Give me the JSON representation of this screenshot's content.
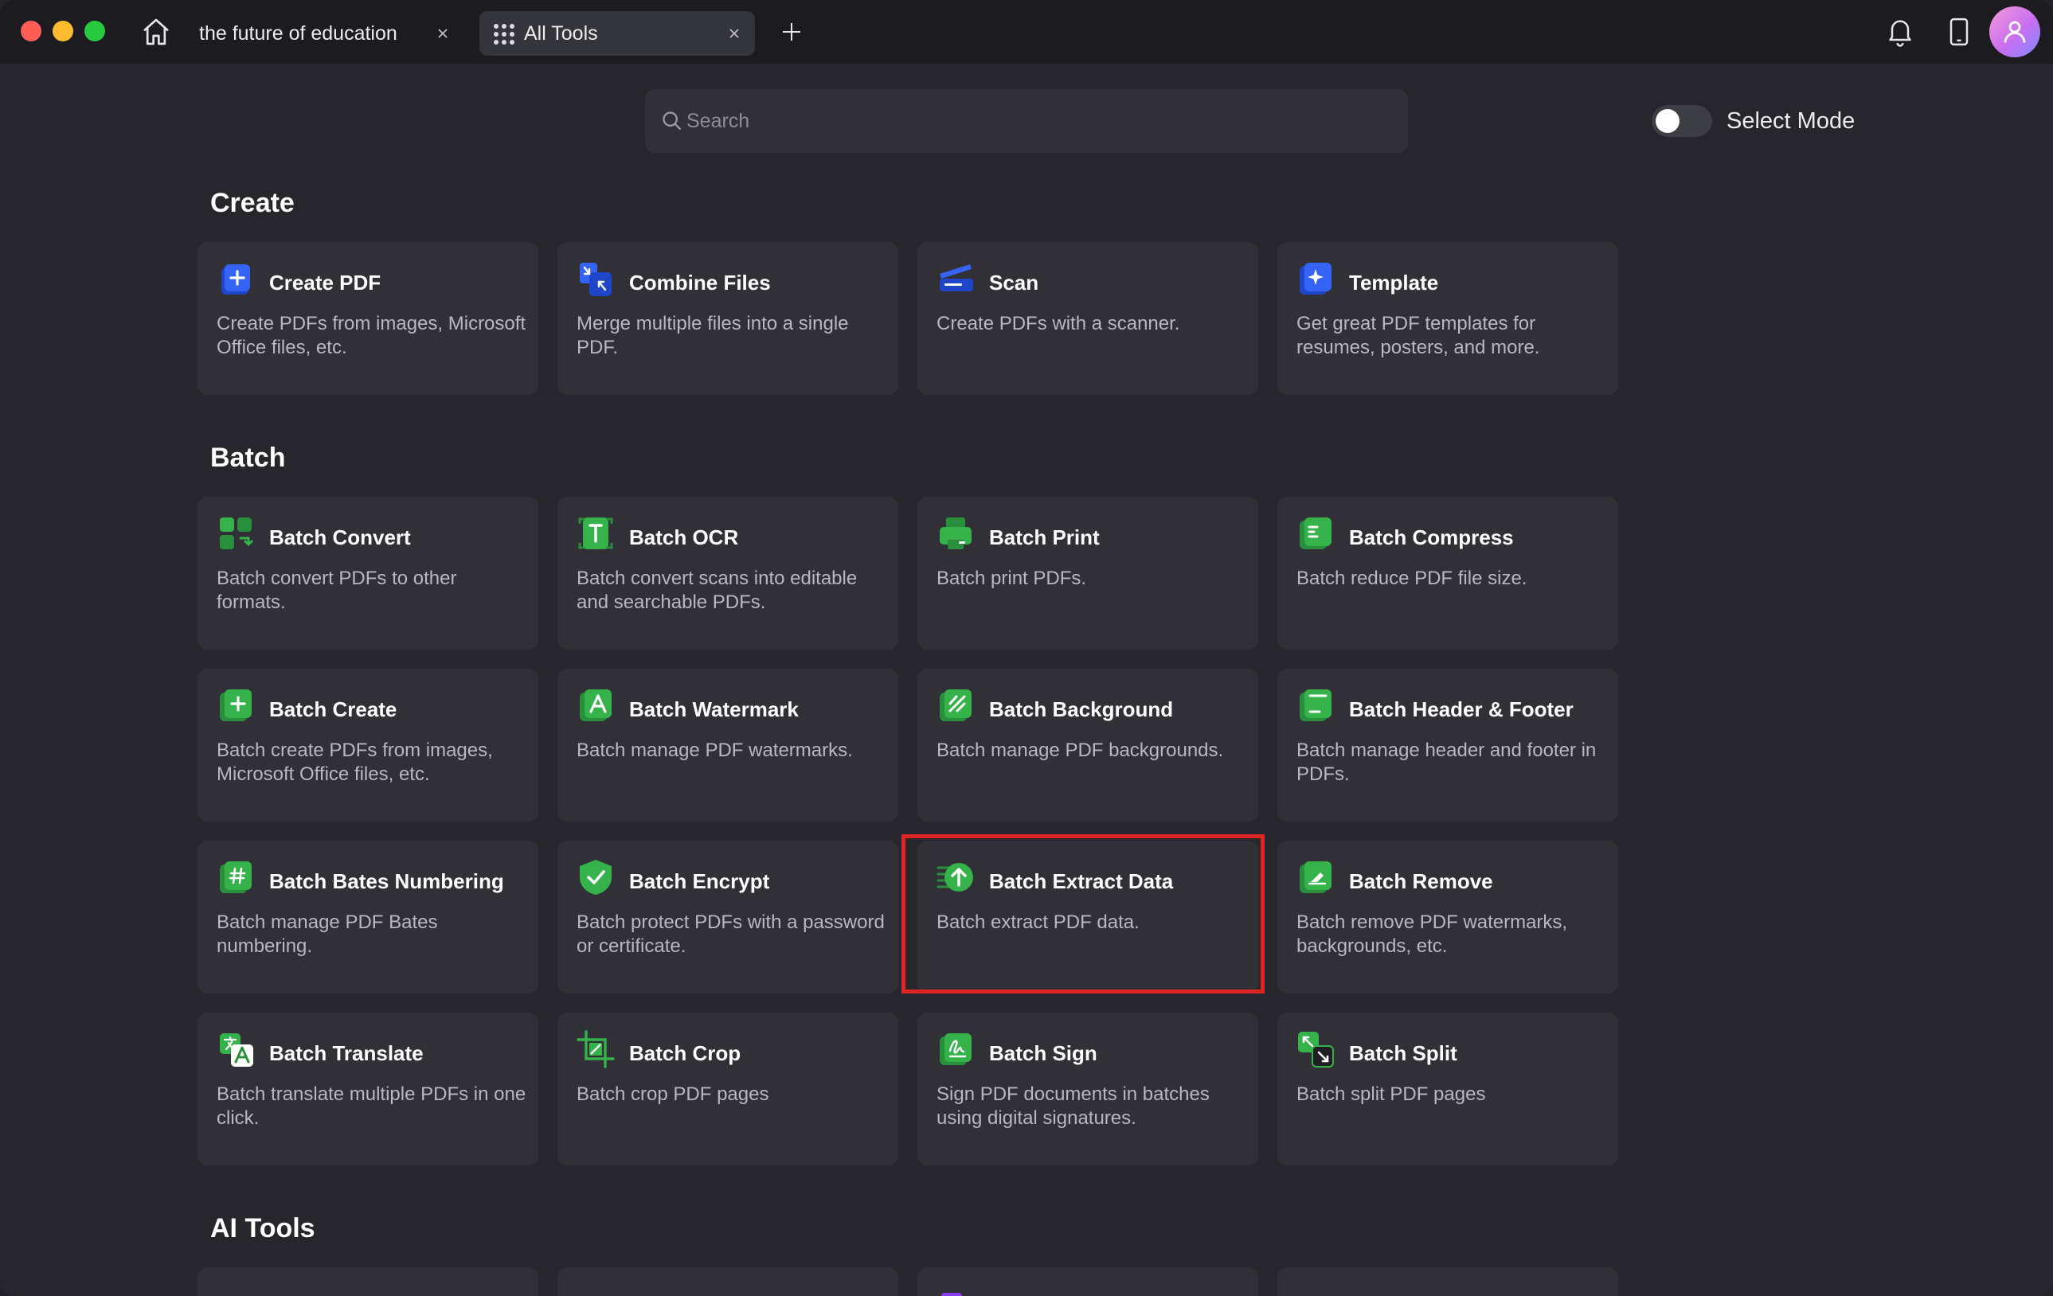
{
  "tabs": [
    {
      "label": "the future of education"
    },
    {
      "label": "All Tools"
    }
  ],
  "search": {
    "placeholder": "Search"
  },
  "select_mode": {
    "label": "Select Mode",
    "enabled": false
  },
  "sections": {
    "create": {
      "title": "Create",
      "cards": [
        {
          "title": "Create PDF",
          "desc": "Create PDFs from images, Microsoft Office files, etc.",
          "icon": "create-pdf-icon"
        },
        {
          "title": "Combine Files",
          "desc": "Merge multiple files into a single PDF.",
          "icon": "combine-files-icon"
        },
        {
          "title": "Scan",
          "desc": "Create PDFs with a scanner.",
          "icon": "scan-icon"
        },
        {
          "title": "Template",
          "desc": "Get great PDF templates for resumes, posters, and more.",
          "icon": "template-icon"
        }
      ]
    },
    "batch": {
      "title": "Batch",
      "cards": [
        {
          "title": "Batch Convert",
          "desc": "Batch convert PDFs to other formats.",
          "icon": "batch-convert-icon"
        },
        {
          "title": "Batch OCR",
          "desc": "Batch convert scans into editable and searchable PDFs.",
          "icon": "batch-ocr-icon"
        },
        {
          "title": "Batch Print",
          "desc": "Batch print PDFs.",
          "icon": "batch-print-icon"
        },
        {
          "title": "Batch Compress",
          "desc": "Batch reduce PDF file size.",
          "icon": "batch-compress-icon"
        },
        {
          "title": "Batch Create",
          "desc": "Batch create PDFs from images, Microsoft Office files, etc.",
          "icon": "batch-create-icon"
        },
        {
          "title": "Batch Watermark",
          "desc": "Batch manage PDF watermarks.",
          "icon": "batch-watermark-icon"
        },
        {
          "title": "Batch Background",
          "desc": "Batch manage PDF backgrounds.",
          "icon": "batch-background-icon"
        },
        {
          "title": "Batch Header & Footer",
          "desc": "Batch manage header and footer in PDFs.",
          "icon": "batch-header-footer-icon"
        },
        {
          "title": "Batch Bates Numbering",
          "desc": "Batch manage PDF Bates numbering.",
          "icon": "batch-bates-icon"
        },
        {
          "title": "Batch Encrypt",
          "desc": "Batch protect PDFs with a password or certificate.",
          "icon": "batch-encrypt-icon"
        },
        {
          "title": "Batch Extract Data",
          "desc": "Batch extract PDF data.",
          "icon": "batch-extract-icon"
        },
        {
          "title": "Batch Remove",
          "desc": "Batch remove PDF watermarks, backgrounds, etc.",
          "icon": "batch-remove-icon"
        },
        {
          "title": "Batch Translate",
          "desc": "Batch translate multiple PDFs in one click.",
          "icon": "batch-translate-icon"
        },
        {
          "title": "Batch Crop",
          "desc": "Batch crop PDF pages",
          "icon": "batch-crop-icon"
        },
        {
          "title": "Batch Sign",
          "desc": "Sign PDF documents in batches using digital signatures.",
          "icon": "batch-sign-icon"
        },
        {
          "title": "Batch Split",
          "desc": "Batch split PDF pages",
          "icon": "batch-split-icon"
        }
      ]
    },
    "ai": {
      "title": "AI Tools"
    }
  },
  "colors": {
    "background": "#26262c",
    "card": "#303036",
    "create_accent": "#2f5cf5",
    "batch_accent": "#35b24a",
    "ai_accent": "#8a3df0",
    "highlight": "#e02424"
  }
}
